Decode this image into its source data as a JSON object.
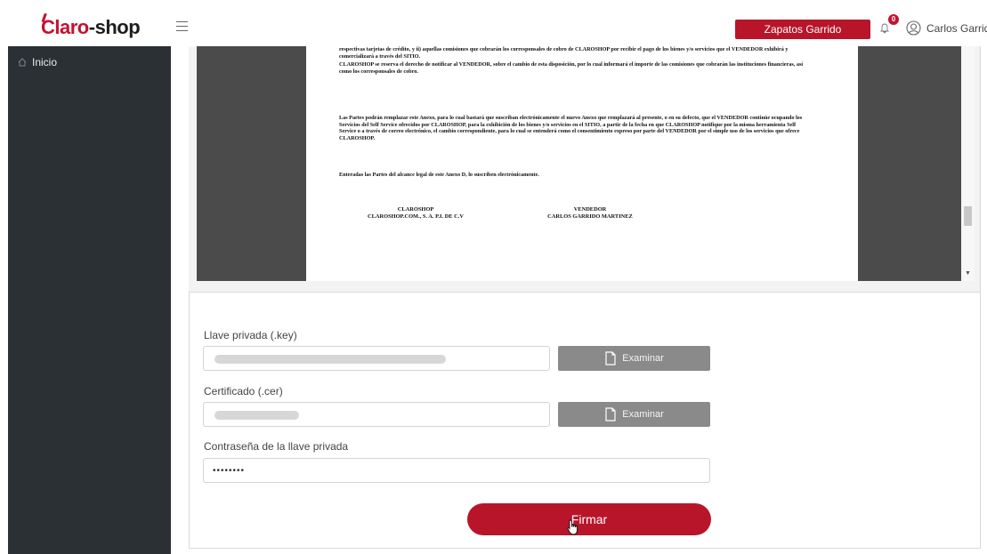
{
  "brand": {
    "logo_text_1": "Claro",
    "logo_text_2": "shop"
  },
  "header": {
    "store_button": "Zapatos Garrido",
    "notifications_count": "0",
    "user_name": "Carlos Garrido"
  },
  "sidebar": {
    "items": [
      {
        "label": "Inicio",
        "icon": "home-icon"
      }
    ]
  },
  "document": {
    "paragraph_1": "respectivas tarjetas de crédito, y ii) aquellas comisiones que cobrarán los corresponsales de cobro de CLAROSHOP por recibir el pago de los bienes y/o servicios que el VENDEDOR exhibirá y comercializará a través del SITIO.",
    "paragraph_2": "CLAROSHOP se reserva el derecho de notificar al VENDEDOR, sobre el cambio de esta disposición, por lo cual informará el importe de las comisiones que cobrarán las instituciones financieras, así como los corresponsales de cobro.",
    "paragraph_3": "Las Partes podrán remplazar este Anexo, para lo cual bastará que suscriban electrónicamente el nuevo Anexo que remplazará al presente, o en su defecto, que el VENDEDOR continúe ocupando los Servicios del Self Service ofrecidos por CLAROSHOP, para la exhibición de los bienes y/o servicios en el SITIO, a partir de la fecha en que CLAROSHOP notifique por la misma herramienta Self Service o a través de correo electrónico, el cambio correspondiente, para lo cual se entenderá como el consentimiento expreso por parte del VENDEDOR por el simple uso de los servicios que ofrece CLAROSHOP.",
    "paragraph_4": "Enteradas las Partes del alcance legal de este Anexo D, lo suscriben electrónicamente.",
    "sig_left_1": "CLAROSHOP",
    "sig_left_2": "CLAROSHOP.COM., S. A. P.I. DE C.V",
    "sig_right_1": "VENDEDOR",
    "sig_right_2": "CARLOS GARRIDO MARTINEZ"
  },
  "form": {
    "key_label": "Llave privada (.key)",
    "cer_label": "Certificado (.cer)",
    "password_label": "Contraseña de la llave privada",
    "password_value": "••••••••",
    "browse_label": "Examinar",
    "sign_button": "Firmar"
  },
  "colors": {
    "brand_red": "#b8152b",
    "sidebar_bg": "#2b3035",
    "button_gray": "#8a8a8a"
  }
}
